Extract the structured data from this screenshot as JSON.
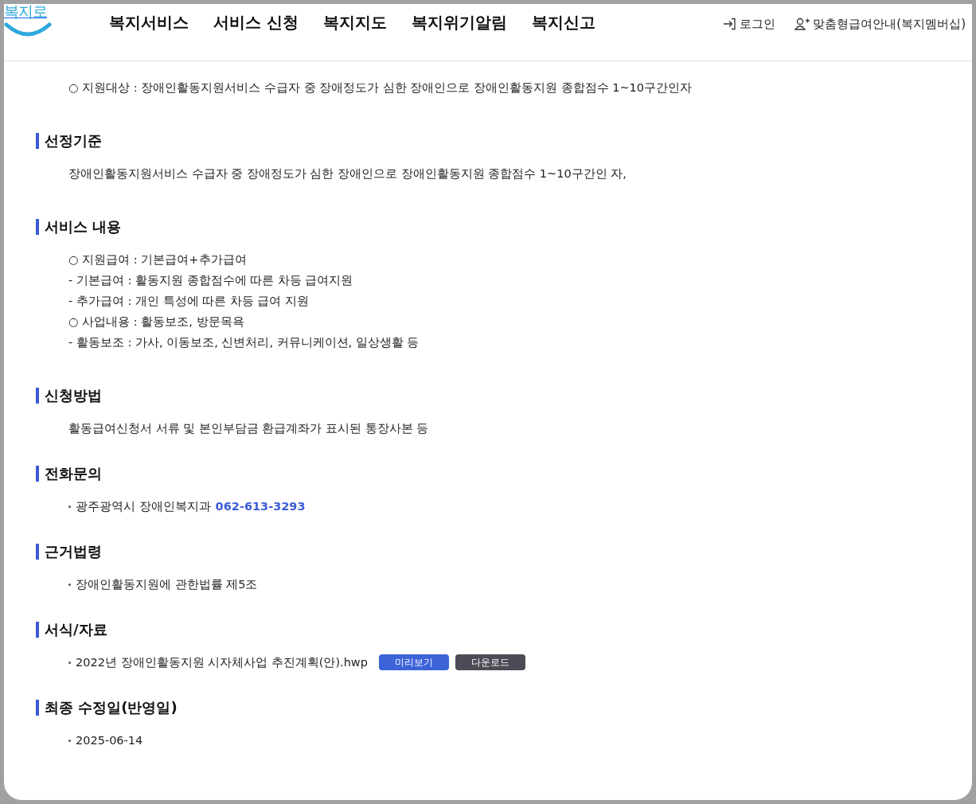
{
  "header": {
    "logo": "복지로",
    "nav": [
      "복지서비스",
      "서비스 신청",
      "복지지도",
      "복지위기알림",
      "복지신고"
    ],
    "login": "로그인",
    "membership": "맞춤형급여안내(복지멤버십)"
  },
  "intro": [
    "○ 지원대상 : 장애인활동지원서비스 수급자 중 장애정도가 심한 장애인으로 장애인활동지원 종합점수 1~10구간인자"
  ],
  "sections": [
    {
      "title": "선정기준",
      "kind": "lines",
      "lines": [
        "장애인활동지원서비스 수급자 중 장애정도가 심한 장애인으로 장애인활동지원 종합점수 1~10구간인 자,"
      ]
    },
    {
      "title": "서비스 내용",
      "kind": "lines",
      "lines": [
        "○ 지원급여 : 기본급여+추가급여",
        "- 기본급여 : 활동지원 종합점수에 따른 차등 급여지원",
        "- 추가급여 : 개인 특성에 따른 차등 급여 지원",
        "○ 사업내용 : 활동보조, 방문목욕",
        "- 활동보조 : 가사, 이동보조, 신변처리, 커뮤니케이션, 일상생활 등"
      ]
    },
    {
      "title": "신청방법",
      "kind": "lines",
      "lines": [
        "활동급여신청서 서류 및 본인부담금 환급계좌가 표시된 통장사본 등"
      ]
    },
    {
      "title": "전화문의",
      "kind": "bullets",
      "items": [
        {
          "text": "광주광역시 장애인복지과",
          "phone": "062-613-3293"
        }
      ]
    },
    {
      "title": "근거법령",
      "kind": "bullets",
      "items": [
        {
          "text": "장애인활동지원에 관한법률 제5조"
        }
      ]
    },
    {
      "title": "서식/자료",
      "kind": "bullets",
      "items": [
        {
          "text": "2022년 장애인활동지원 시자체사업 추진계획(안).hwp",
          "preview": "미리보기",
          "download": "다운로드"
        }
      ]
    },
    {
      "title": "최종 수정일(반영일)",
      "kind": "bullets",
      "items": [
        {
          "text": "2025-06-14"
        }
      ]
    }
  ]
}
